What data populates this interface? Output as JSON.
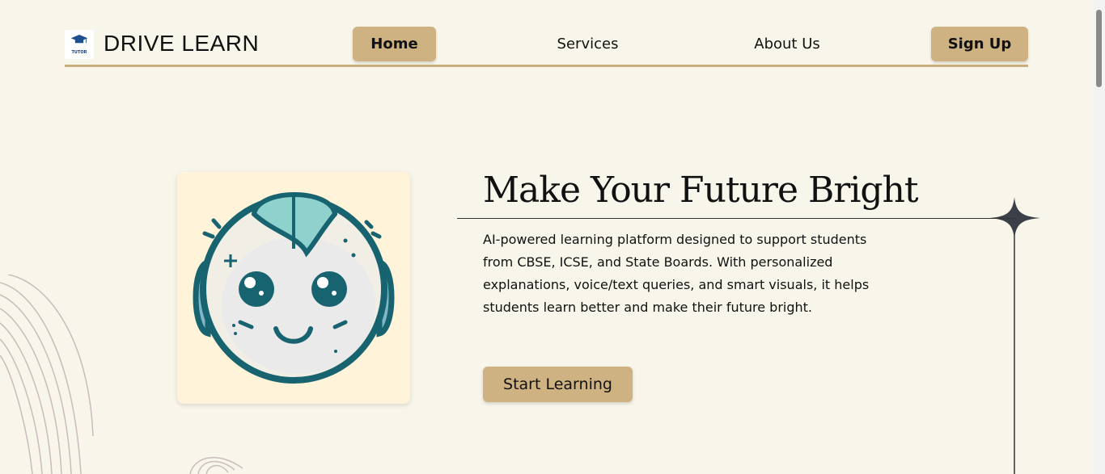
{
  "header": {
    "logo_icon": "graduation-cap-icon",
    "logo_small_text": "TUTOR",
    "brand": "DRIVE LEARN",
    "nav": [
      {
        "label": "Home",
        "active": true
      },
      {
        "label": "Services",
        "active": false
      },
      {
        "label": "About Us",
        "active": false
      }
    ],
    "signup_label": "Sign Up"
  },
  "hero": {
    "title": "Make Your Future Bright",
    "description": "AI-powered learning platform designed to support students from CBSE, ICSE, and State Boards. With personalized explanations, voice/text queries, and smart visuals, it helps students learn better and make their future bright.",
    "cta_label": "Start Learning",
    "mascot_icon": "robot-face-icon"
  },
  "colors": {
    "background": "#f8f5ea",
    "accent": "#cfb282",
    "rule": "#c8ae7d",
    "mascot_teal": "#17636f"
  }
}
